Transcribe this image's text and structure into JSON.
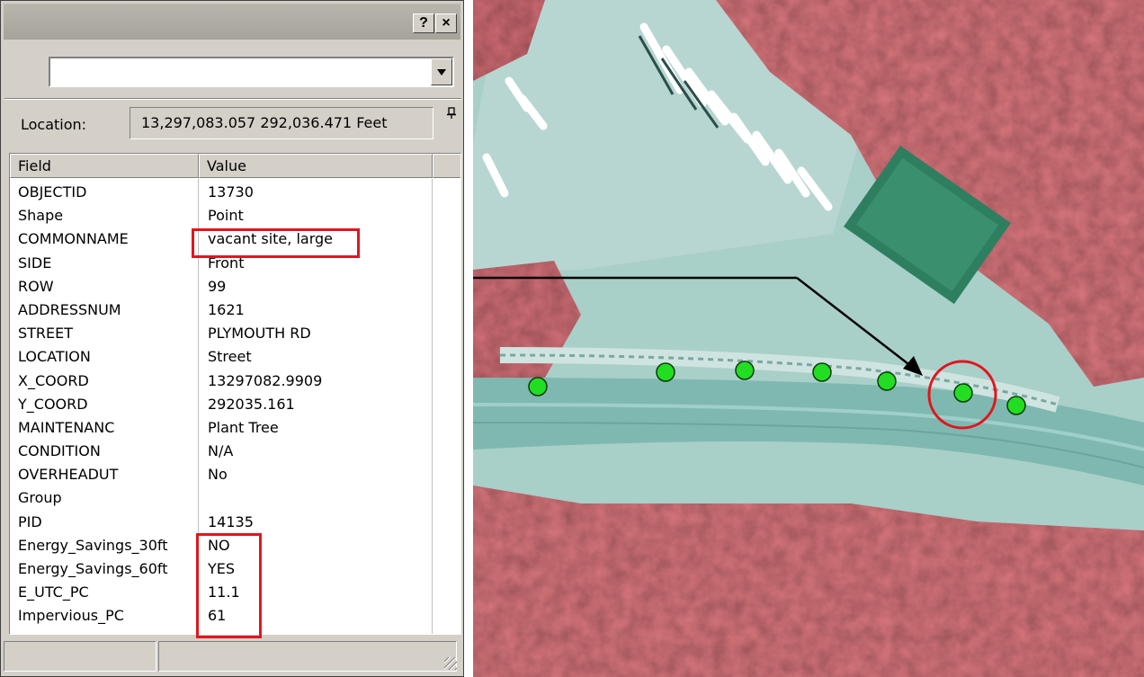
{
  "panel": {
    "help_button": "?",
    "close_button": "×",
    "layer_combo": "",
    "location_label": "Location:",
    "location_value": "13,297,083.057  292,036.471 Feet",
    "columns": {
      "field": "Field",
      "value": "Value"
    },
    "rows": [
      {
        "field": "OBJECTID",
        "value": "13730"
      },
      {
        "field": "Shape",
        "value": "Point"
      },
      {
        "field": "COMMONNAME",
        "value": "vacant site, large"
      },
      {
        "field": "SIDE",
        "value": "Front"
      },
      {
        "field": "ROW",
        "value": "99"
      },
      {
        "field": "ADDRESSNUM",
        "value": "1621"
      },
      {
        "field": "STREET",
        "value": "PLYMOUTH RD"
      },
      {
        "field": "LOCATION",
        "value": "Street"
      },
      {
        "field": "X_COORD",
        "value": "13297082.9909"
      },
      {
        "field": "Y_COORD",
        "value": "292035.161"
      },
      {
        "field": "MAINTENANC",
        "value": "Plant Tree"
      },
      {
        "field": "CONDITION",
        "value": "N/A"
      },
      {
        "field": "OVERHEADUT",
        "value": "No"
      },
      {
        "field": "Group",
        "value": ""
      },
      {
        "field": "PID",
        "value": "14135"
      },
      {
        "field": "Energy_Savings_30ft",
        "value": "NO"
      },
      {
        "field": "Energy_Savings_60ft",
        "value": "YES"
      },
      {
        "field": "E_UTC_PC",
        "value": "11.1"
      },
      {
        "field": "Impervious_PC",
        "value": "61"
      }
    ]
  },
  "map": {
    "point_color": "#22dd22",
    "highlight_color": "#e0161e",
    "vegetation_color": "#d9777d",
    "pavement_color": "#8fc2bd"
  },
  "colors": {
    "panel_bg": "#d4d0c8",
    "annotation_red": "#e0161e"
  }
}
